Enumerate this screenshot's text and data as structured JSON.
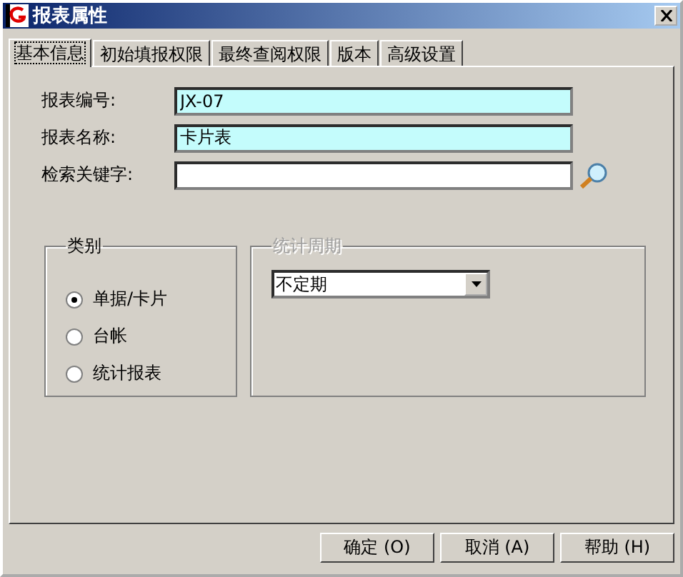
{
  "window": {
    "title": "报表属性"
  },
  "tabs": [
    {
      "label": "基本信息",
      "selected": true
    },
    {
      "label": "初始填报权限",
      "selected": false
    },
    {
      "label": "最终查阅权限",
      "selected": false
    },
    {
      "label": "版本",
      "selected": false
    },
    {
      "label": "高级设置",
      "selected": false
    }
  ],
  "fields": [
    {
      "label": "报表编号:",
      "value": "JX-07",
      "highlighted": true
    },
    {
      "label": "报表名称:",
      "value": "卡片表",
      "highlighted": true
    },
    {
      "label": "检索关键字:",
      "highlighted": false
    }
  ],
  "category": {
    "title": "类别",
    "options": [
      {
        "label": "单据/卡片",
        "selected": true
      },
      {
        "label": "台帐",
        "selected": false
      },
      {
        "label": "统计报表",
        "selected": false
      }
    ]
  },
  "period": {
    "title": "统计周期",
    "disabled": true,
    "value": "不定期"
  },
  "buttons": [
    "确定 (O)",
    "取消 (A)",
    "帮助 (H)"
  ]
}
